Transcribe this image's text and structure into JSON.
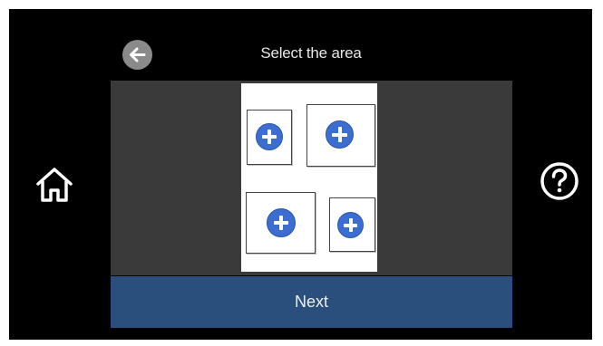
{
  "header": {
    "title": "Select the area",
    "back_icon": "arrow-left-icon"
  },
  "navigation": {
    "home_icon": "home-icon",
    "help_icon": "question-mark-icon"
  },
  "preview": {
    "areas": [
      {
        "icon": "plus-icon"
      },
      {
        "icon": "plus-icon"
      },
      {
        "icon": "plus-icon"
      },
      {
        "icon": "plus-icon"
      }
    ]
  },
  "footer": {
    "next_label": "Next"
  },
  "colors": {
    "screen_background": "#000000",
    "preview_background": "#3a3a3a",
    "next_button": "#2b4f7c",
    "plus_icon": "#3b6ed0"
  }
}
